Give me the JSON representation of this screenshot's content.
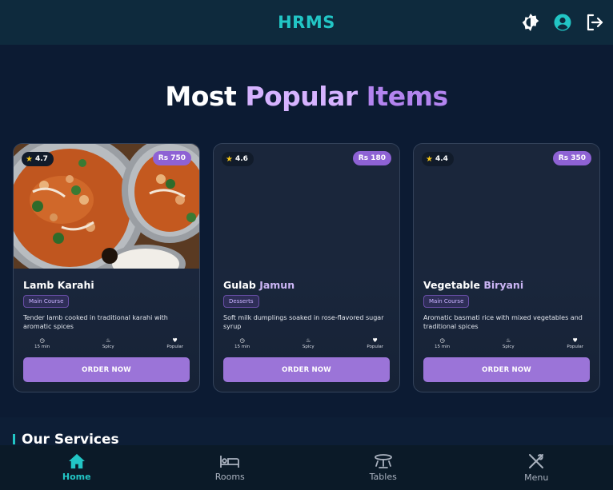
{
  "header": {
    "brand": "HRMS",
    "icons": [
      "theme-toggle-icon",
      "account-icon",
      "logout-icon"
    ]
  },
  "hero": {
    "title_parts": [
      "Most",
      "Popular",
      "Items"
    ]
  },
  "cards": [
    {
      "rating": "4.7",
      "price": "Rs 750",
      "name_parts": [
        "Lamb Karahi",
        ""
      ],
      "category": "Main Course",
      "description": "Tender lamb cooked in traditional karahi with aromatic spices",
      "features": [
        {
          "icon": "clock-icon",
          "label": "15 min"
        },
        {
          "icon": "fire-icon",
          "label": "Spicy"
        },
        {
          "icon": "heart-icon",
          "label": "Popular"
        }
      ],
      "button": "ORDER NOW",
      "has_image": true
    },
    {
      "rating": "4.6",
      "price": "Rs 180",
      "name_parts": [
        "Gulab ",
        "Jamun"
      ],
      "category": "Desserts",
      "description": "Soft milk dumplings soaked in rose-flavored sugar syrup",
      "features": [
        {
          "icon": "clock-icon",
          "label": "15 min"
        },
        {
          "icon": "fire-icon",
          "label": "Spicy"
        },
        {
          "icon": "heart-icon",
          "label": "Popular"
        }
      ],
      "button": "ORDER NOW",
      "has_image": false
    },
    {
      "rating": "4.4",
      "price": "Rs 350",
      "name_parts": [
        "Vegetable ",
        "Biryani"
      ],
      "category": "Main Course",
      "description": "Aromatic basmati rice with mixed vegetables and traditional spices",
      "features": [
        {
          "icon": "clock-icon",
          "label": "15 min"
        },
        {
          "icon": "fire-icon",
          "label": "Spicy"
        },
        {
          "icon": "heart-icon",
          "label": "Popular"
        }
      ],
      "button": "ORDER NOW",
      "has_image": false
    }
  ],
  "services": {
    "title": "Our Services"
  },
  "bottom_nav": [
    {
      "label": "Home",
      "icon": "home-icon",
      "active": true
    },
    {
      "label": "Rooms",
      "icon": "bed-icon",
      "active": false
    },
    {
      "label": "Tables",
      "icon": "table-icon",
      "active": false
    },
    {
      "label": "Menu",
      "icon": "utensils-icon",
      "active": false
    }
  ],
  "colors": {
    "accent": "#22c5c5",
    "purple": "#9b74d8",
    "background": "#0c1b33"
  }
}
